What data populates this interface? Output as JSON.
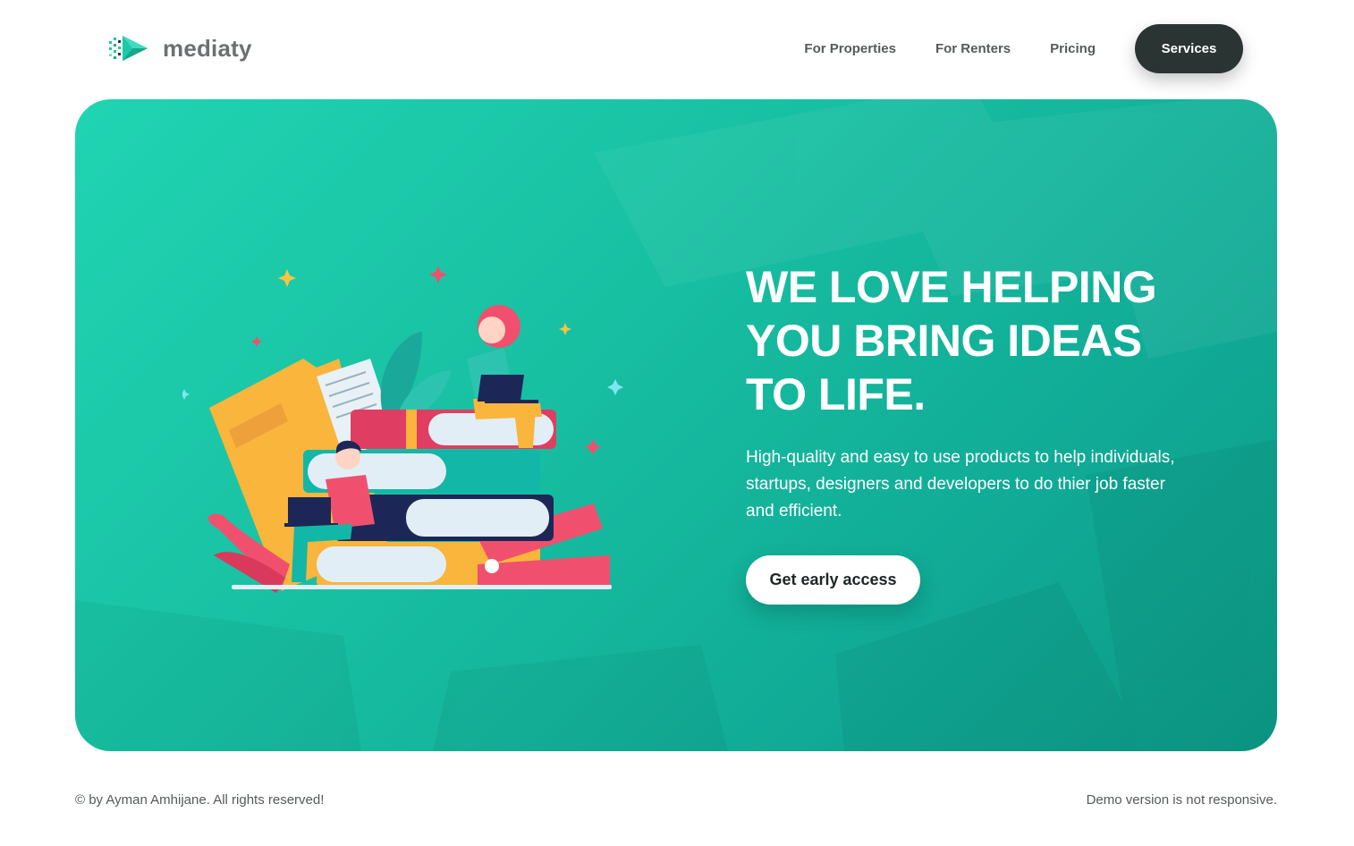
{
  "brand": {
    "name": "mediaty",
    "icon": "play-logo-icon",
    "accent": "#1ec9a8"
  },
  "nav": {
    "items": [
      {
        "label": "For Properties"
      },
      {
        "label": "For Renters"
      },
      {
        "label": "Pricing"
      }
    ],
    "cta_label": "Services"
  },
  "hero": {
    "title_lines": [
      "WE LOVE HELPING",
      "YOU BRING IDEAS",
      "TO LIFE."
    ],
    "subtitle": "High-quality and easy to use products to help individuals, startups, designers and developers to do thier job faster and efficient.",
    "cta_label": "Get early access",
    "illustration": "people-on-books-illustration",
    "colors": {
      "gradient_start": "#20d4b2",
      "gradient_end": "#0c9a86",
      "dark_button": "#2a3433"
    }
  },
  "footer": {
    "copyright": "© by Ayman Amhijane. All rights reserved!",
    "note": "Demo version is not responsive."
  }
}
